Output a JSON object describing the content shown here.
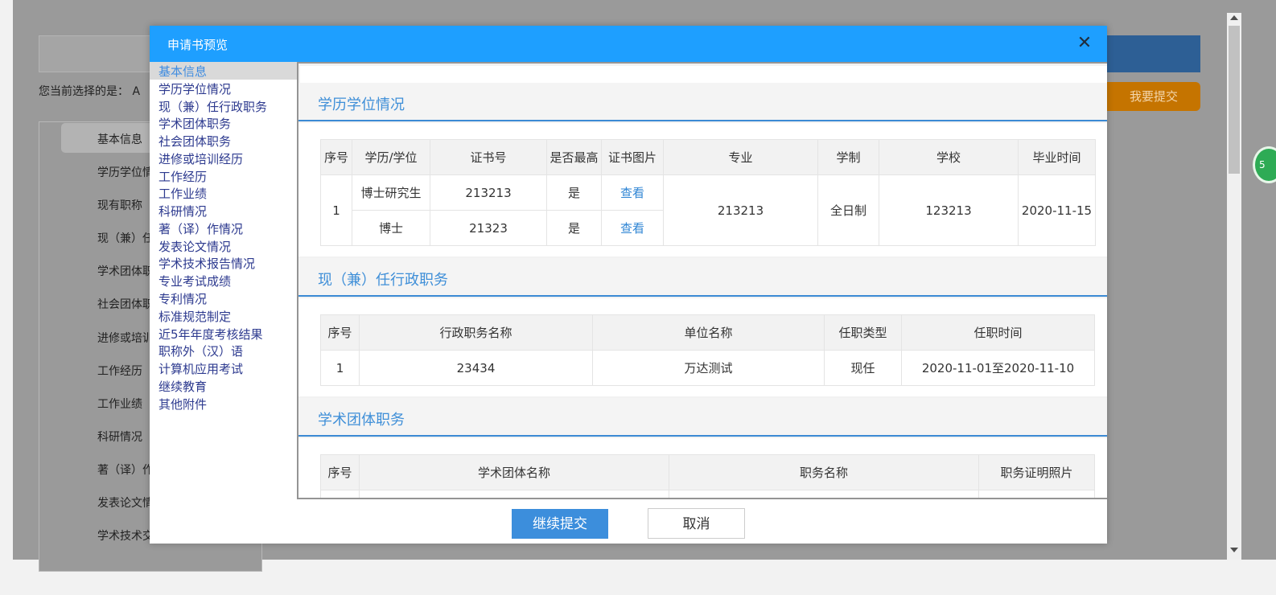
{
  "background": {
    "current_selection_label": "您当前选择的是：  A",
    "submit_button": "我要提交",
    "badge_text": "5",
    "side_items": [
      "基本信息",
      "学历学位情",
      "现有职称",
      "现（兼）任",
      "学术团体职",
      "社会团体职",
      "进修或培训",
      "工作经历",
      "工作业绩",
      "科研情况",
      "著（译）作",
      "发表论文情",
      "学术技术交"
    ]
  },
  "modal": {
    "title": "申请书预览",
    "close_icon": "close-icon",
    "nav_items": [
      "基本信息",
      "学历学位情况",
      "现（兼）任行政职务",
      "学术团体职务",
      "社会团体职务",
      "进修或培训经历",
      "工作经历",
      "工作业绩",
      "科研情况",
      "著（译）作情况",
      "发表论文情况",
      "学术技术报告情况",
      "专业考试成绩",
      "专利情况",
      "标准规范制定",
      "近5年年度考核结果",
      "职称外（汉）语",
      "计算机应用考试",
      "继续教育",
      "其他附件"
    ],
    "active_nav": "基本信息",
    "sections": {
      "education": {
        "title": "学历学位情况",
        "headers": [
          "序号",
          "学历/学位",
          "证书号",
          "是否最高",
          "证书图片",
          "专业",
          "学制",
          "学校",
          "毕业时间"
        ],
        "rows": [
          {
            "index": "1",
            "degree": "博士研究生",
            "cert_no": "213213",
            "highest": "是",
            "image": "查看",
            "major": "213213",
            "system": "全日制",
            "school": "123213",
            "grad": "2020-11-15"
          },
          {
            "degree": "博士",
            "cert_no": "21323",
            "highest": "是",
            "image": "查看"
          }
        ]
      },
      "admin": {
        "title": "现（兼）任行政职务",
        "headers": [
          "序号",
          "行政职务名称",
          "单位名称",
          "任职类型",
          "任职时间"
        ],
        "rows": [
          {
            "index": "1",
            "name": "23434",
            "unit": "万达测试",
            "type": "现任",
            "time": "2020-11-01至2020-11-10"
          }
        ]
      },
      "academic": {
        "title": "学术团体职务",
        "headers": [
          "序号",
          "学术团体名称",
          "职务名称",
          "职务证明照片"
        ]
      }
    },
    "buttons": {
      "continue": "继续提交",
      "cancel": "取消"
    }
  },
  "colors": {
    "header_blue": "#1e9fff",
    "section_title": "#3f8fd8",
    "nav_text": "#2d3a8f",
    "orange": "#c57400"
  }
}
